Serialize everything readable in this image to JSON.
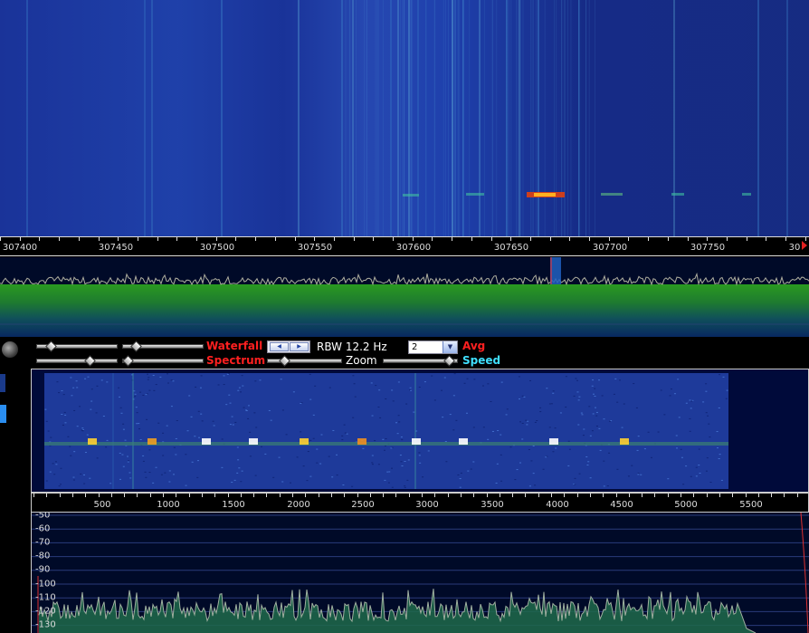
{
  "top_ruler": {
    "labels": [
      "307400",
      "307450",
      "307500",
      "307550",
      "307600",
      "307650",
      "307700",
      "307750",
      "30"
    ]
  },
  "controls": {
    "waterfall_label": "Waterfall",
    "spectrum_label": "Spectrum",
    "rbw_label": "RBW 12.2 Hz",
    "zoom_label": "Zoom",
    "avg_value": "2",
    "avg_label": "Avg",
    "speed_label": "Speed"
  },
  "low_ruler": {
    "labels": [
      "500",
      "1000",
      "1500",
      "2000",
      "2500",
      "3000",
      "3500",
      "4000",
      "4500",
      "5000",
      "5500"
    ]
  },
  "low_spectrum": {
    "db_labels": [
      "-50",
      "-60",
      "-70",
      "-80",
      "-90",
      "-100",
      "-110",
      "-120",
      "-130"
    ]
  },
  "colors": {
    "waterfall_blue": "#1a3399",
    "spectrum_green": "#1e8c1e",
    "label_red": "#ff2020",
    "label_cyan": "#40e0ff"
  }
}
